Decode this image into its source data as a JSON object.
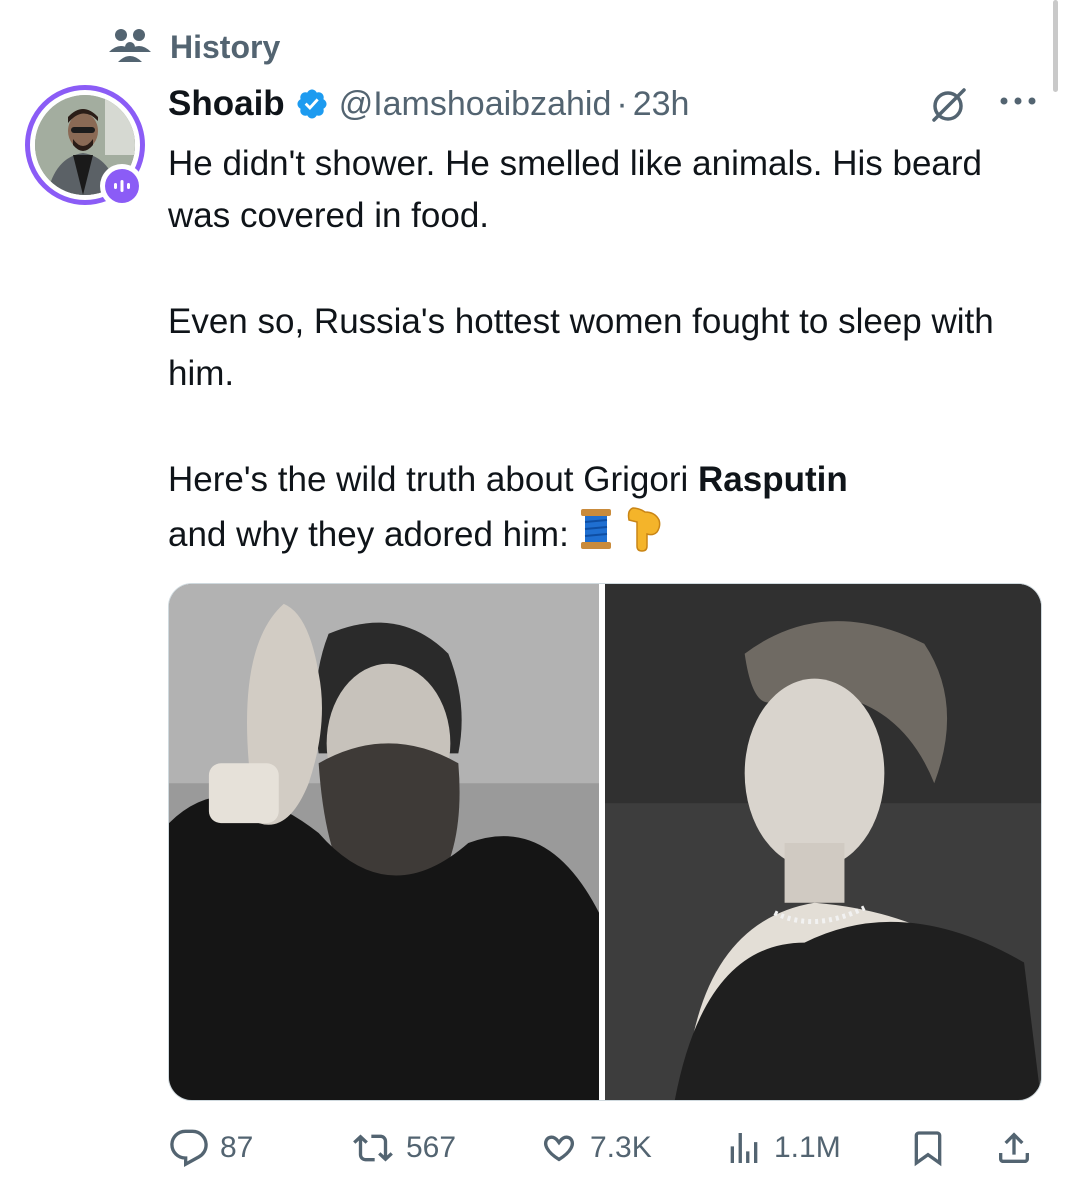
{
  "context": {
    "label": "History",
    "icon": "community-icon"
  },
  "post": {
    "author": {
      "name": "Shoaib",
      "handle": "@Iamshoaibzahid",
      "verified": true,
      "verified_color": "#1d9bf0"
    },
    "separator": "·",
    "time": "23h",
    "text": {
      "p1": "He didn't shower. He smelled like animals. His beard was covered in food.",
      "p2": "Even so, Russia's hottest women fought to sleep with him.",
      "p3_prefix": "Here's the wild truth about Grigori ",
      "p3_bold": "Rasputin",
      "p3_suffix": "and why they adored him:",
      "emojis": [
        "🧵",
        "👇"
      ]
    },
    "media": [
      {
        "description_icon": "rasputin-photo"
      },
      {
        "description_icon": "woman-portrait-photo"
      }
    ]
  },
  "actions": {
    "replies": "87",
    "reposts": "567",
    "likes": "7.3K",
    "views": "1.1M"
  },
  "colors": {
    "accent_ring": "#8b5cf6",
    "muted": "#536471",
    "text": "#0f1419",
    "verified": "#1d9bf0"
  }
}
